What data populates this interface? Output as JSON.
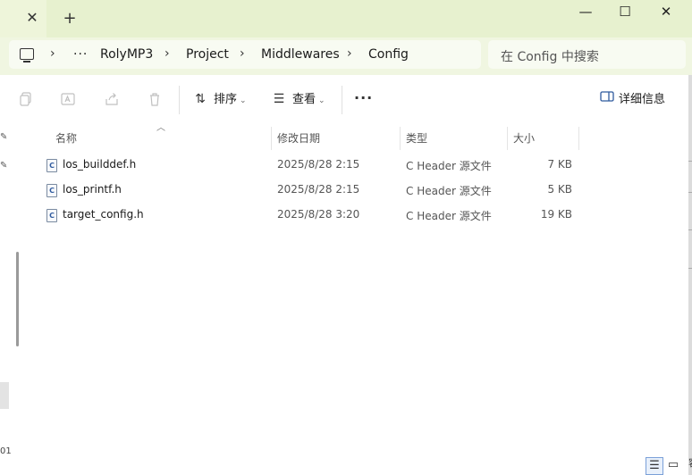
{
  "window": {
    "tab_close_glyph": "✕",
    "new_tab_glyph": "+",
    "minimize_glyph": "—",
    "maximize_glyph": "☐",
    "close_glyph": "✕"
  },
  "address": {
    "overflow": "···",
    "breadcrumbs": [
      "RolyMP3",
      "Project",
      "Middlewares",
      "Config"
    ],
    "separator": "›"
  },
  "search": {
    "placeholder": "在 Config 中搜索"
  },
  "toolbar": {
    "sort_label": "排序",
    "view_label": "查看",
    "more_glyph": "···",
    "details_label": "详细信息"
  },
  "columns": {
    "name": "名称",
    "date": "修改日期",
    "type": "类型",
    "size": "大小"
  },
  "files": [
    {
      "name": "los_builddef.h",
      "date": "2025/8/28 2:15",
      "type": "C Header 源文件",
      "size": "7 KB"
    },
    {
      "name": "los_printf.h",
      "date": "2025/8/28 2:15",
      "type": "C Header 源文件",
      "size": "5 KB"
    },
    {
      "name": "target_config.h",
      "date": "2025/8/28 3:20",
      "type": "C Header 源文件",
      "size": "19 KB"
    }
  ],
  "file_icon_letter": "C",
  "nav": {
    "partial_text": "01"
  },
  "corner_text": "容",
  "colors": {
    "titlebar": "#e7f1cf",
    "addressbar_row": "#f0f6e1",
    "accent": "#7aa0d8"
  }
}
